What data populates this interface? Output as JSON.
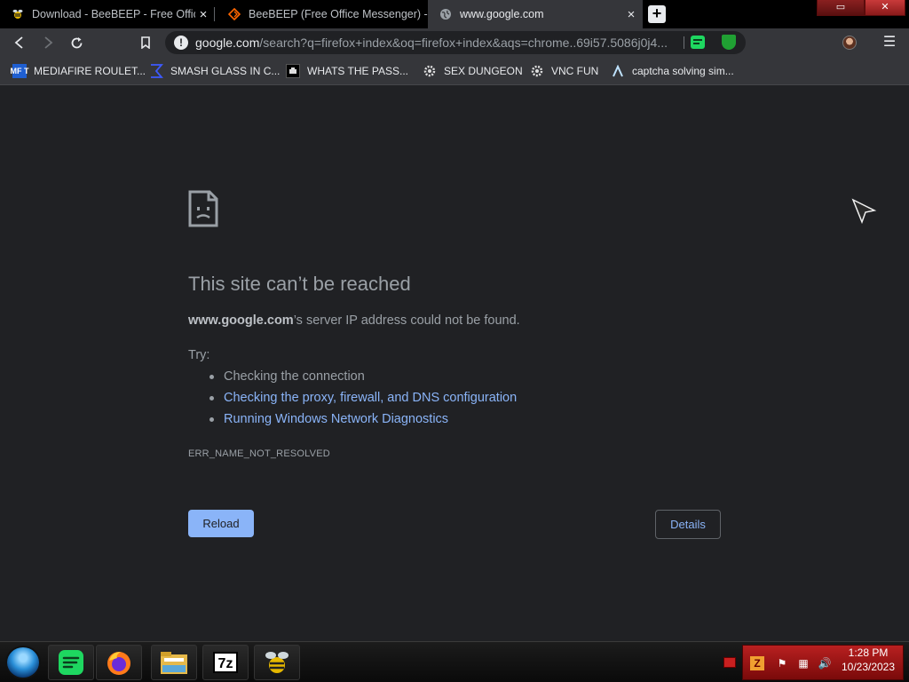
{
  "tabs": [
    {
      "title": "Download - BeeBEEP - Free Office",
      "icon": "beebeep-icon"
    },
    {
      "title": "BeeBEEP (Free Office Messenger) - ",
      "icon": "sourceforge-icon"
    },
    {
      "title": "www.google.com",
      "icon": "globe-icon",
      "active": true
    }
  ],
  "toolbar": {
    "url_host": "google.com",
    "url_path": "/search?q=firefox+index&oq=firefox+index&aqs=chrome..69i57.5086j0j4..."
  },
  "bookmarks": [
    {
      "label": "MEDIAFIRE ROULET...",
      "icon": "mediafire-icon",
      "badge": "MF T"
    },
    {
      "label": "SMASH GLASS IN C...",
      "icon": "chevron-icon"
    },
    {
      "label": "WHATS THE PASS...",
      "icon": "terminal-icon"
    },
    {
      "label": "SEX DUNGEON",
      "icon": "gear-icon"
    },
    {
      "label": "VNC FUN",
      "icon": "gear-icon"
    },
    {
      "label": "captcha solving sim...",
      "icon": "lambda-icon"
    }
  ],
  "error": {
    "title": "This site can’t be reached",
    "host": "www.google.com",
    "desc_suffix": "’s server IP address could not be found.",
    "try_label": "Try:",
    "suggestions": [
      {
        "text": "Checking the connection",
        "link": false
      },
      {
        "text": "Checking the proxy, firewall, and DNS configuration",
        "link": true
      },
      {
        "text": "Running Windows Network Diagnostics",
        "link": true
      }
    ],
    "code": "ERR_NAME_NOT_RESOLVED",
    "reload_label": "Reload",
    "details_label": "Details"
  },
  "taskbar": {
    "apps": [
      "spotify-icon",
      "firefox-icon",
      "file-explorer-icon",
      "7zip-icon",
      "beebeep-icon"
    ],
    "sevenzip_label": "7z",
    "time": "1:28 PM",
    "date": "10/23/2023"
  },
  "colors": {
    "page_bg": "#202124",
    "link": "#8ab4f8",
    "text": "#9aa0a6",
    "button_bg": "#8ab4f8"
  }
}
